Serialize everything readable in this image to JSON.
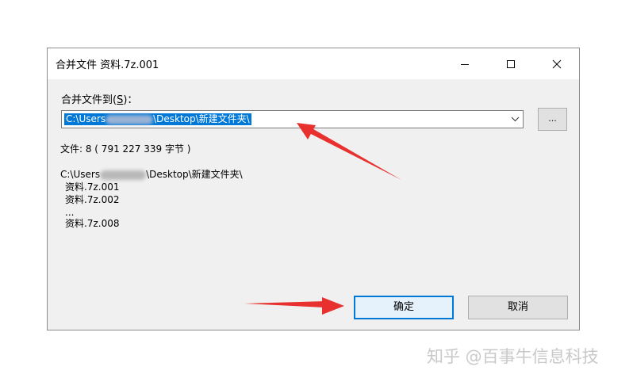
{
  "window": {
    "title": "合并文件 资料.7z.001"
  },
  "merge_to": {
    "label": "合并文件到(",
    "accelerator": "S",
    "label_suffix": ")：",
    "path_prefix": "C:\\Users",
    "path_suffix": "\\Desktop\\新建文件夹\\"
  },
  "browse_button": {
    "label": "..."
  },
  "file_count": {
    "text": "文件: 8  ( 791 227 339 字节 )"
  },
  "file_list": {
    "dir_prefix": "C:\\Users",
    "dir_suffix": "\\Desktop\\新建文件夹\\",
    "items": [
      "资料.7z.001",
      "资料.7z.002",
      "...",
      "资料.7z.008"
    ]
  },
  "buttons": {
    "ok": "确定",
    "cancel": "取消"
  },
  "watermark": {
    "text": "知乎 @百事牛信息科技"
  },
  "colors": {
    "selection": "#0078d7",
    "arrow": "#e8312f",
    "dialog_bg": "#f0f0f0"
  },
  "icons": {
    "minimize": "minimize-icon",
    "maximize": "maximize-icon",
    "close": "close-icon",
    "dropdown": "chevron-down-icon",
    "annotation_arrows": "red-arrow-icon"
  }
}
